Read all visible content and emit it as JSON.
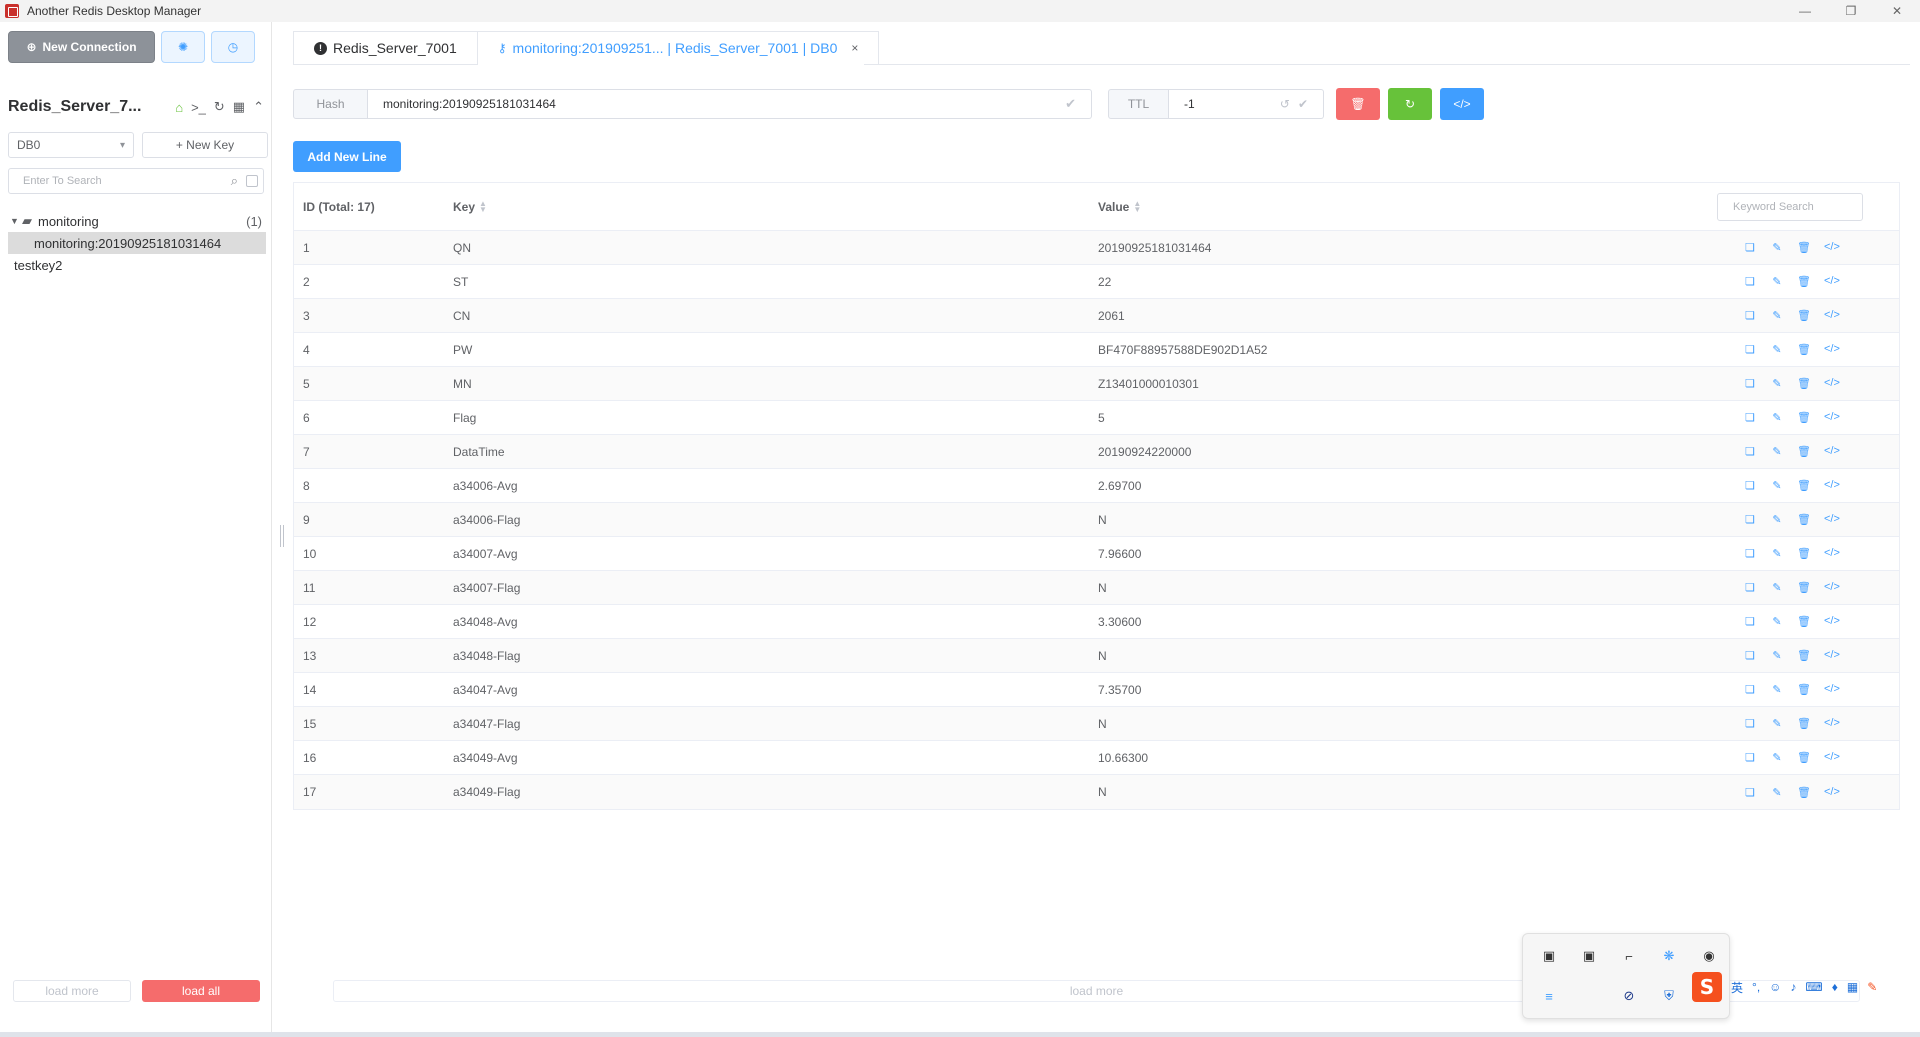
{
  "window": {
    "title": "Another Redis Desktop Manager"
  },
  "sidebar": {
    "new_connection_label": "New Connection",
    "server_name": "Redis_Server_7...",
    "db_selected": "DB0",
    "new_key_label": "+ New Key",
    "search_placeholder": "Enter To Search",
    "tree": {
      "folder_name": "monitoring",
      "folder_count": "(1)",
      "selected_key": "monitoring:20190925181031464",
      "other_key": "testkey2"
    },
    "load_more_label": "load more",
    "load_all_label": "load all"
  },
  "tabs": [
    {
      "label": "Redis_Server_7001"
    },
    {
      "label": "monitoring:201909251... | Redis_Server_7001 | DB0"
    }
  ],
  "keybar": {
    "type_label": "Hash",
    "key_name": "monitoring:20190925181031464",
    "ttl_label": "TTL",
    "ttl_value": "-1"
  },
  "add_line_label": "Add New Line",
  "table": {
    "col_id": "ID (Total: 17)",
    "col_key": "Key",
    "col_value": "Value",
    "keyword_placeholder": "Keyword Search",
    "rows": [
      {
        "id": "1",
        "key": "QN",
        "value": "20190925181031464"
      },
      {
        "id": "2",
        "key": "ST",
        "value": "22"
      },
      {
        "id": "3",
        "key": "CN",
        "value": "2061"
      },
      {
        "id": "4",
        "key": "PW",
        "value": "BF470F88957588DE902D1A52"
      },
      {
        "id": "5",
        "key": "MN",
        "value": "Z13401000010301"
      },
      {
        "id": "6",
        "key": "Flag",
        "value": "5"
      },
      {
        "id": "7",
        "key": "DataTime",
        "value": "20190924220000"
      },
      {
        "id": "8",
        "key": "a34006-Avg",
        "value": "2.69700"
      },
      {
        "id": "9",
        "key": "a34006-Flag",
        "value": "N"
      },
      {
        "id": "10",
        "key": "a34007-Avg",
        "value": "7.96600"
      },
      {
        "id": "11",
        "key": "a34007-Flag",
        "value": "N"
      },
      {
        "id": "12",
        "key": "a34048-Avg",
        "value": "3.30600"
      },
      {
        "id": "13",
        "key": "a34048-Flag",
        "value": "N"
      },
      {
        "id": "14",
        "key": "a34047-Avg",
        "value": "7.35700"
      },
      {
        "id": "15",
        "key": "a34047-Flag",
        "value": "N"
      },
      {
        "id": "16",
        "key": "a34049-Avg",
        "value": "10.66300"
      },
      {
        "id": "17",
        "key": "a34049-Flag",
        "value": "N"
      }
    ]
  },
  "main_load_more_label": "load more",
  "ime": {
    "lang": "英",
    "punct": "°,"
  },
  "colors": {
    "accent": "#409eff",
    "danger": "#f56c6c",
    "success": "#67c23a"
  }
}
